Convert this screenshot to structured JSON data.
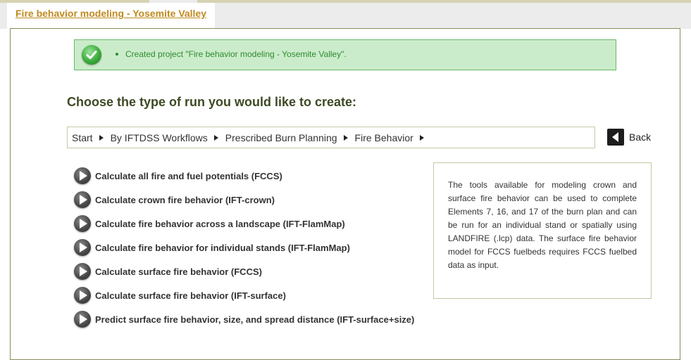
{
  "header": {
    "project_tab_label": "Fire behavior modeling - Yosemite Valley"
  },
  "notification": {
    "icon": "check-icon",
    "message": "Created project \"Fire behavior modeling - Yosemite Valley\"."
  },
  "main": {
    "heading": "Choose the type of run you would like to create:",
    "breadcrumb": [
      "Start",
      "By IFTDSS Workflows",
      "Prescribed Burn Planning",
      "Fire Behavior"
    ],
    "back_label": "Back",
    "run_options": [
      "Calculate all fire and fuel potentials (FCCS)",
      "Calculate crown fire behavior (IFT-crown)",
      "Calculate fire behavior across a landscape (IFT-FlamMap)",
      "Calculate fire behavior for individual stands (IFT-FlamMap)",
      "Calculate surface fire behavior (FCCS)",
      "Calculate surface fire behavior (IFT-surface)",
      "Predict surface fire behavior, size, and spread distance (IFT-surface+size)"
    ],
    "info_text": "The tools available for modeling crown and surface fire behavior can be used to complete Elements 7, 16, and 17 of the burn plan and can be run for an individual stand or spatially using LANDFIRE (.lcp) data. The surface fire behavior model for FCCS fuelbeds requires FCCS fuelbed data as input."
  },
  "colors": {
    "tab_link": "#c08a20",
    "heading": "#3d4a24",
    "success_bg": "#cbeccb",
    "success_border": "#67b867",
    "success_text": "#2f8b2f",
    "panel_border": "#8b8b5a"
  }
}
